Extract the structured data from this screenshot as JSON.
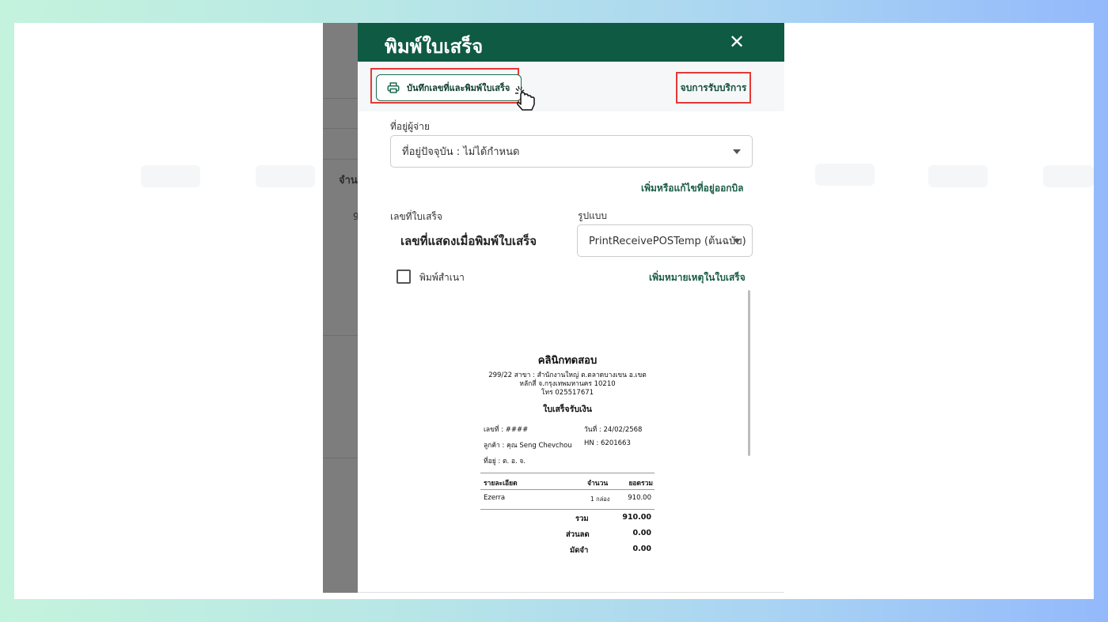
{
  "dialog": {
    "title": "พิมพ์ใบเสร็จ",
    "close_glyph": "✕",
    "save_print_label": "บันทึกเลขที่และพิมพ์ใบเสร็จ",
    "end_service_label": "จบการรับบริการ"
  },
  "background": {
    "column_label": "จำนว",
    "row_value": "9"
  },
  "seller_address": {
    "label": "ที่อยู่ผู้จ่าย",
    "selected": "ที่อยู่ปัจจุบัน : ไม่ได้กำหนด",
    "edit_link": "เพิ่มหรือแก้ไขที่อยู่ออกบิล"
  },
  "receipt_number": {
    "label": "เลขที่ใบเสร็จ",
    "value": "เลขที่แสดงเมื่อพิมพ์ใบเสร็จ"
  },
  "format": {
    "label": "รูปแบบ",
    "selected": "PrintReceivePOSTemp (ต้นฉบับ)"
  },
  "copy_print": {
    "label": "พิมพ์สำเนา",
    "checked": false
  },
  "note_link": "เพิ่มหมายเหตุในใบเสร็จ",
  "receipt": {
    "clinic_name": "คลินิกทดสอบ",
    "address_line1": "299/22 สาขา : สำนักงานใหญ่ ต.ตลาดบางเขน อ.เขต",
    "address_line2": "หลักสี่ จ.กรุงเทพมหานคร 10210",
    "phone": "โทร 025517671",
    "doc_title": "ใบเสร็จรับเงิน",
    "no_label": "เลขที่ : ####",
    "date_label": "วันที่ : 24/02/2568",
    "customer_label": "ลูกค้า : คุณ Seng Chevchou",
    "hn_label": "HN :  6201663",
    "address_label": "ที่อยู่ :    ต. อ. จ.",
    "col_detail": "รายละเอียด",
    "col_qty": "จำนวน",
    "col_total": "ยอดรวม",
    "item_name": "Ezerra",
    "item_qty": "1 กล่อง",
    "item_total": "910.00",
    "sum_label": "รวม",
    "sum_value": "910.00",
    "discount_label": "ส่วนลด",
    "discount_value": "0.00",
    "deposit_label": "มัดจำ",
    "deposit_value": "0.00"
  },
  "colors": {
    "header_green": "#0f5a42",
    "highlight_red": "#e53935",
    "link_green": "#1a5c47"
  }
}
